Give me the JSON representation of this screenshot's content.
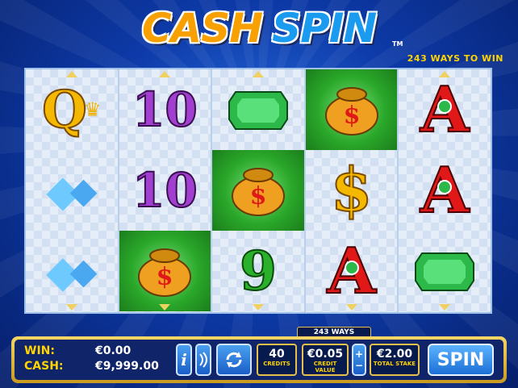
{
  "game": {
    "logo_word1": "CASH",
    "logo_word2": "SPIN",
    "trademark": "TM",
    "ways_top": "243 WAYS TO WIN"
  },
  "reels": [
    [
      {
        "symbol": "Q",
        "name": "queen-crown-icon"
      },
      {
        "symbol": "◆",
        "name": "diamond-icon"
      },
      {
        "symbol": "◆",
        "name": "diamond-icon"
      }
    ],
    [
      {
        "symbol": "10",
        "name": "ten-icon"
      },
      {
        "symbol": "10",
        "name": "ten-icon"
      },
      {
        "symbol": "$",
        "name": "money-bag-icon",
        "highlight": true
      }
    ],
    [
      {
        "symbol": "◆",
        "name": "emerald-icon"
      },
      {
        "symbol": "$",
        "name": "money-bag-icon",
        "highlight": true
      },
      {
        "symbol": "9",
        "name": "nine-icon"
      }
    ],
    [
      {
        "symbol": "$",
        "name": "money-bag-icon",
        "highlight": true
      },
      {
        "symbol": "$",
        "name": "dollar-icon"
      },
      {
        "symbol": "A",
        "name": "ace-icon"
      }
    ],
    [
      {
        "symbol": "A",
        "name": "ace-icon"
      },
      {
        "symbol": "A",
        "name": "ace-icon"
      },
      {
        "symbol": "◆",
        "name": "emerald-icon"
      }
    ]
  ],
  "panel": {
    "win_label": "WIN:",
    "win_value": "€0.00",
    "cash_label": "CASH:",
    "cash_value": "€9,999.00",
    "info_label": "i",
    "ways_label": "243 WAYS",
    "credits_value": "40",
    "credits_label": "CREDITS",
    "credit_value": "€0.05",
    "credit_value_label": "CREDIT VALUE",
    "stake_value": "€2.00",
    "stake_label": "TOTAL STAKE",
    "spin_label": "SPIN"
  },
  "colors": {
    "accent_gold": "#f5b800",
    "brand_blue": "#1a9bf0",
    "highlight_green": "#2aa82a"
  }
}
